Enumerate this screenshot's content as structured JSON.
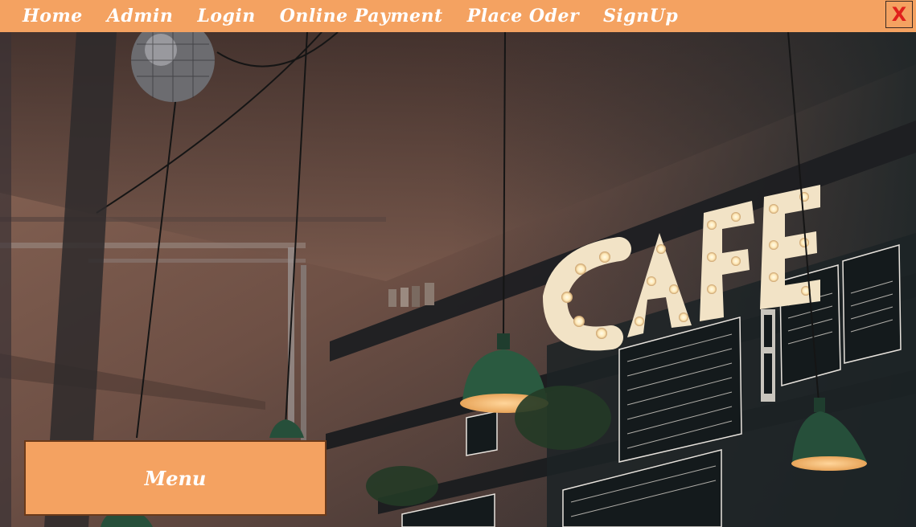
{
  "nav": {
    "items": [
      {
        "label": "Home"
      },
      {
        "label": "Admin"
      },
      {
        "label": "Login"
      },
      {
        "label": "Online Payment"
      },
      {
        "label": "Place Oder"
      },
      {
        "label": "SignUp"
      }
    ],
    "close_label": "X"
  },
  "background": {
    "sign_text": "CAFE"
  },
  "menu_button": {
    "label": "Menu"
  },
  "colors": {
    "accent": "#f4a261",
    "close": "#e0211c"
  }
}
